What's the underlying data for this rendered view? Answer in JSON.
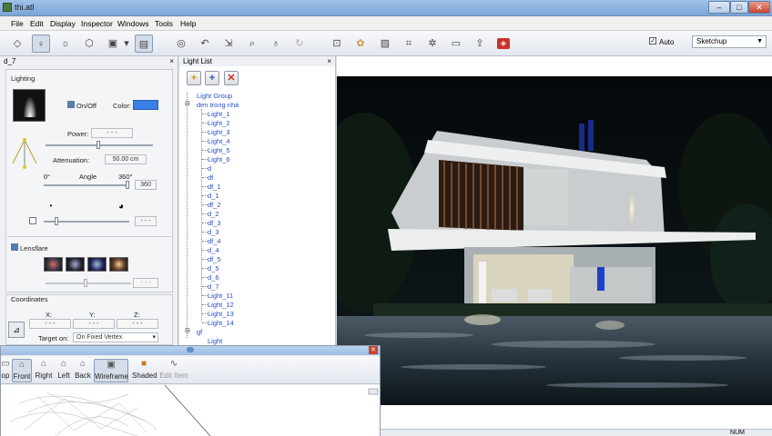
{
  "window": {
    "title": "thi.atl",
    "minimize": "–",
    "maximize": "□",
    "close": "✕"
  },
  "menu": [
    "File",
    "Edit",
    "Display",
    "Inspector",
    "Windows",
    "Tools",
    "Help"
  ],
  "toolbar": {
    "auto_label": "Auto",
    "auto_checked": "✓",
    "preset_value": "Sketchup",
    "icons": [
      "eraser-icon",
      "light-bulb-icon",
      "sun-icon",
      "cube-icon",
      "camera-icon",
      "dropdown-arrow-icon",
      "page-icon",
      "globe-icon",
      "undo-icon",
      "move-icon",
      "zoom-icon",
      "bulb-icon",
      "refresh-icon",
      "frame-icon",
      "palette-icon",
      "image-icon",
      "crop-icon",
      "gear-icon",
      "window-icon",
      "export-icon",
      "render-icon"
    ]
  },
  "properties": {
    "object_name": "d_7",
    "close": "×",
    "lighting_title": "Lighting",
    "on_off_label": "On/Off",
    "color_label": "Color:",
    "color_hex": "#3c7ee8",
    "power_label": "Power:",
    "power_value": "- - -",
    "attenuation_label": "Attenuation:",
    "attenuation_value": "50.00 cm",
    "angle_min": "0°",
    "angle_label": "Angle",
    "angle_max": "360°",
    "angle_value": "360",
    "falloff_value": "- - -",
    "lensflare_label": "Lensflare",
    "lensflare_value": "- - -",
    "coordinates_title": "Coordinates",
    "x_label": "X:",
    "y_label": "Y:",
    "z_label": "Z:",
    "x_value": "- - -",
    "y_value": "- - -",
    "z_value": "- - -",
    "target_label": "Target on:",
    "target_value": "On Fixed Vertex"
  },
  "light_list": {
    "title": "Light List",
    "close": "×",
    "group_root": "Light Group",
    "group_den": "den trong nhà",
    "items": [
      "Light_1",
      "Light_2",
      "Light_3",
      "Light_4",
      "Light_5",
      "Light_6",
      "d",
      "df",
      "df_1",
      "d_1",
      "df_2",
      "d_2",
      "df_3",
      "d_3",
      "df_4",
      "d_4",
      "df_5",
      "d_5",
      "d_6",
      "d_7",
      "Light_11",
      "Light_12",
      "Light_13",
      "Light_14"
    ],
    "group_gf": "gf",
    "partial_item": "Light"
  },
  "viewport": {
    "buttons": [
      "op",
      "Front",
      "Right",
      "Left",
      "Back",
      "Wireframe",
      "Shaded",
      "Edit Item"
    ]
  },
  "status": {
    "num": "NUM"
  }
}
